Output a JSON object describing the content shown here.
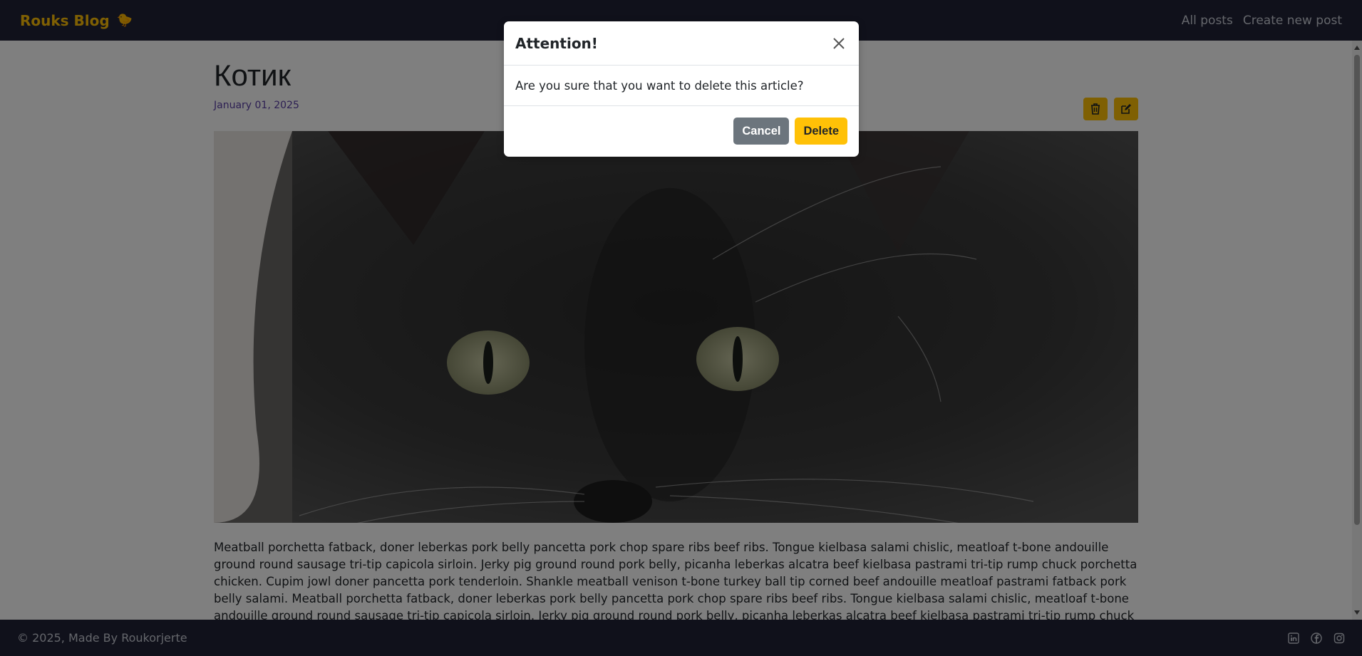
{
  "navbar": {
    "brand": "Rouks Blog",
    "brand_icon": "duck-emoji",
    "links": [
      "All posts",
      "Create new post"
    ]
  },
  "post": {
    "title": "Котик",
    "date": "January 01, 2025",
    "image": "black-cat-photo",
    "body": "Meatball porchetta fatback, doner leberkas pork belly pancetta pork chop spare ribs beef ribs. Tongue kielbasa salami chislic, meatloaf t-bone andouille ground round sausage tri-tip capicola sirloin. Jerky pig ground round pork belly, picanha leberkas alcatra beef kielbasa pastrami tri-tip rump chuck porchetta chicken. Cupim jowl doner pancetta pork tenderloin. Shankle meatball venison t-bone turkey ball tip corned beef andouille meatloaf pastrami fatback pork belly salami. Meatball porchetta fatback, doner leberkas pork belly pancetta pork chop spare ribs beef ribs. Tongue kielbasa salami chislic, meatloaf t-bone andouille ground round sausage tri-tip capicola sirloin. Jerky pig ground round pork belly, picanha leberkas alcatra beef kielbasa pastrami tri-tip rump chuck porchetta chicken. Cupim jowl doner"
  },
  "modal": {
    "title": "Attention!",
    "message": "Are you sure that you want to delete this article?",
    "cancel_label": "Cancel",
    "delete_label": "Delete"
  },
  "footer": {
    "text": "© 2025, Made By Roukorjerte",
    "social_icons": [
      "linkedin-icon",
      "facebook-icon",
      "instagram-icon"
    ]
  },
  "colors": {
    "navbar_bg": "#212337",
    "accent": "#ffc107",
    "date": "#5a3fa6",
    "cancel": "#6c757d"
  }
}
